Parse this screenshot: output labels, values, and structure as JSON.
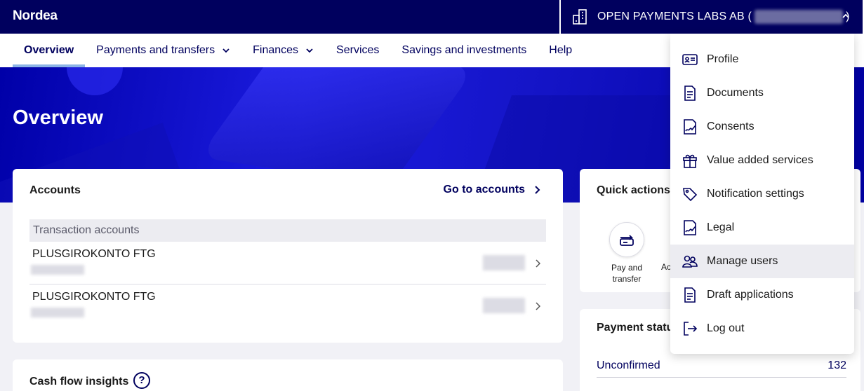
{
  "brand": "Nordea",
  "company": {
    "name": "OPEN PAYMENTS LABS AB (",
    "suffix": ")"
  },
  "nav": [
    {
      "label": "Overview",
      "active": true,
      "dropdown": false
    },
    {
      "label": "Payments and transfers",
      "dropdown": true
    },
    {
      "label": "Finances",
      "dropdown": true
    },
    {
      "label": "Services",
      "dropdown": false
    },
    {
      "label": "Savings and investments",
      "dropdown": false
    },
    {
      "label": "Help",
      "dropdown": false
    }
  ],
  "hero": {
    "title": "Overview"
  },
  "accounts": {
    "title": "Accounts",
    "go_to_accounts": "Go to accounts",
    "group_label": "Transaction accounts",
    "rows": [
      {
        "name": "PLUSGIROKONTO FTG"
      },
      {
        "name": "PLUSGIROKONTO FTG"
      }
    ]
  },
  "cashflow": {
    "title": "Cash flow insights",
    "help_icon": "?"
  },
  "quick_actions": {
    "title": "Quick actions",
    "actions": [
      {
        "label": "Pay and transfer",
        "icon": "pay-transfer-icon"
      },
      {
        "label": "Ac",
        "icon": ""
      }
    ]
  },
  "payment_status": {
    "title": "Payment statu",
    "rows": [
      {
        "label": "Unconfirmed",
        "count": "132"
      }
    ]
  },
  "menu": {
    "items": [
      {
        "label": "Profile",
        "icon": "id-card-icon"
      },
      {
        "label": "Documents",
        "icon": "document-icon"
      },
      {
        "label": "Consents",
        "icon": "signature-icon"
      },
      {
        "label": "Value added services",
        "icon": "gift-icon"
      },
      {
        "label": "Notification settings",
        "icon": "tag-icon"
      },
      {
        "label": "Legal",
        "icon": "signature-icon"
      },
      {
        "label": "Manage users",
        "icon": "users-icon",
        "hover": true
      },
      {
        "label": "Draft applications",
        "icon": "document-icon"
      },
      {
        "label": "Log out",
        "icon": "logout-icon"
      }
    ]
  },
  "colors": {
    "primary": "#00005e",
    "accent": "#8cb4e6",
    "hero": "#0000a8"
  }
}
